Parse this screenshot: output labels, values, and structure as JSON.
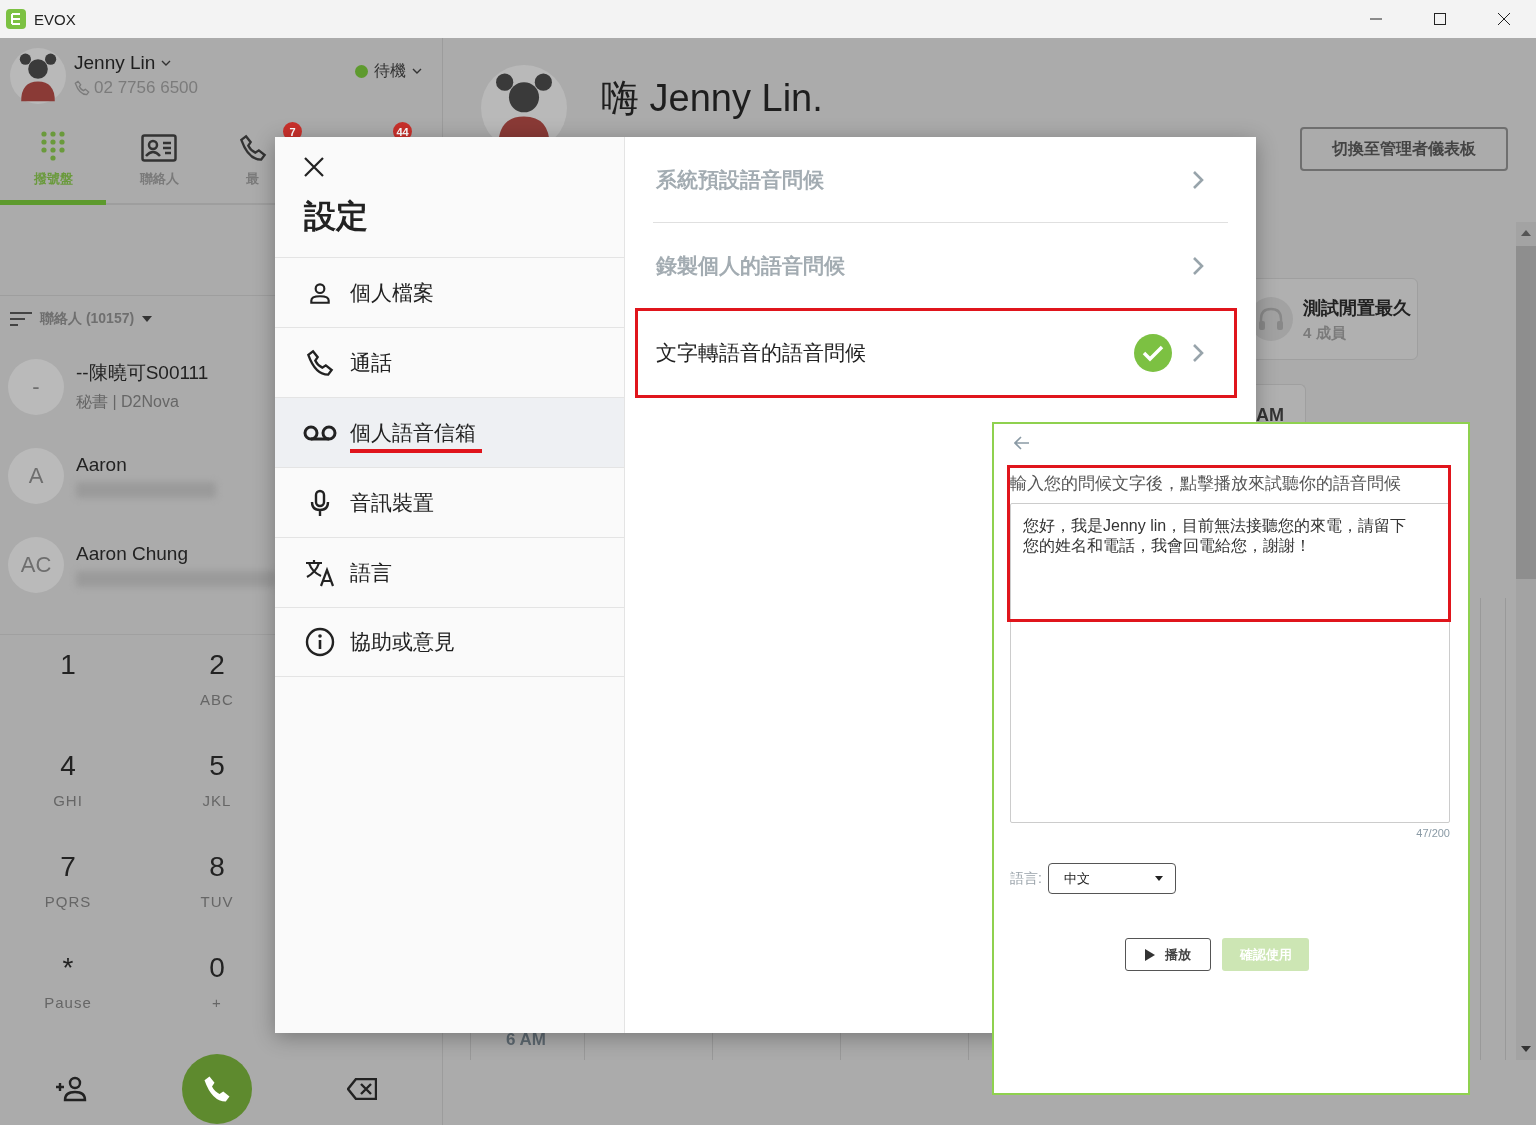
{
  "window": {
    "title": "EVOX"
  },
  "user": {
    "name": "Jenny Lin",
    "phone": "02 7756 6500",
    "status": "待機"
  },
  "nav_tabs": [
    {
      "kind": "dialpad",
      "label": "撥號盤",
      "selected": true
    },
    {
      "kind": "contacts",
      "label": "聯絡人",
      "selected": false
    },
    {
      "kind": "recent",
      "label": "最",
      "selected": false,
      "badge": "7"
    }
  ],
  "covered_tab_badge": "44",
  "contacts_filter": {
    "label": "聯絡人 (10157)"
  },
  "contacts": [
    {
      "avatar": "-",
      "name": "--陳曉可S00111",
      "detail": "秘書 | D2Nova",
      "blurred": false
    },
    {
      "avatar": "A",
      "name": "Aaron",
      "blurred": true
    },
    {
      "avatar": "AC",
      "name": "Aaron Chung",
      "blurred": true
    }
  ],
  "keypad": [
    {
      "digit": "1"
    },
    {
      "digit": "2",
      "letters": "ABC"
    },
    {
      "digit": "4",
      "letters": "GHI"
    },
    {
      "digit": "5",
      "letters": "JKL"
    },
    {
      "digit": "7",
      "letters": "PQRS"
    },
    {
      "digit": "8",
      "letters": "TUV"
    },
    {
      "digit": "*",
      "letters": "Pause"
    },
    {
      "digit": "0",
      "letters": "+"
    }
  ],
  "welcome": {
    "title": "嗨 Jenny Lin."
  },
  "admin_button": "切換至管理者儀表板",
  "queue_card": {
    "name": "測試閒置最久",
    "members": "4 成員"
  },
  "partial_card": {
    "text": "AM"
  },
  "calendar": {
    "time_label": "6 AM"
  },
  "settings": {
    "title": "設定",
    "menu": [
      {
        "kind": "profile",
        "label": "個人檔案",
        "selected": false,
        "underlined": false
      },
      {
        "kind": "call",
        "label": "通話",
        "selected": false,
        "underlined": false
      },
      {
        "kind": "voicemail",
        "label": "個人語音信箱",
        "selected": true,
        "underlined": true
      },
      {
        "kind": "audio",
        "label": "音訊裝置",
        "selected": false,
        "underlined": false
      },
      {
        "kind": "language",
        "label": "語言",
        "selected": false,
        "underlined": false
      },
      {
        "kind": "help",
        "label": "協助或意見",
        "selected": false,
        "underlined": false
      }
    ],
    "greetings": [
      {
        "label": "系統預設語音問候",
        "active": false,
        "highlighted": false
      },
      {
        "label": "錄製個人的語音問候",
        "active": false,
        "highlighted": false
      },
      {
        "label": "文字轉語音的語音問候",
        "active": true,
        "highlighted": true
      }
    ]
  },
  "tts": {
    "hint": "輸入您的問候文字後，點擊播放來試聽你的語音問候",
    "highlighted": true,
    "text": "您好，我是Jenny lin，目前無法接聽您的來電，請留下您的姓名和電話，我會回電給您，謝謝！",
    "counter": "47/200",
    "language_label": "語言:",
    "language": "中文",
    "play": "播放",
    "confirm": {
      "label": "確認使用",
      "disabled": true
    }
  }
}
